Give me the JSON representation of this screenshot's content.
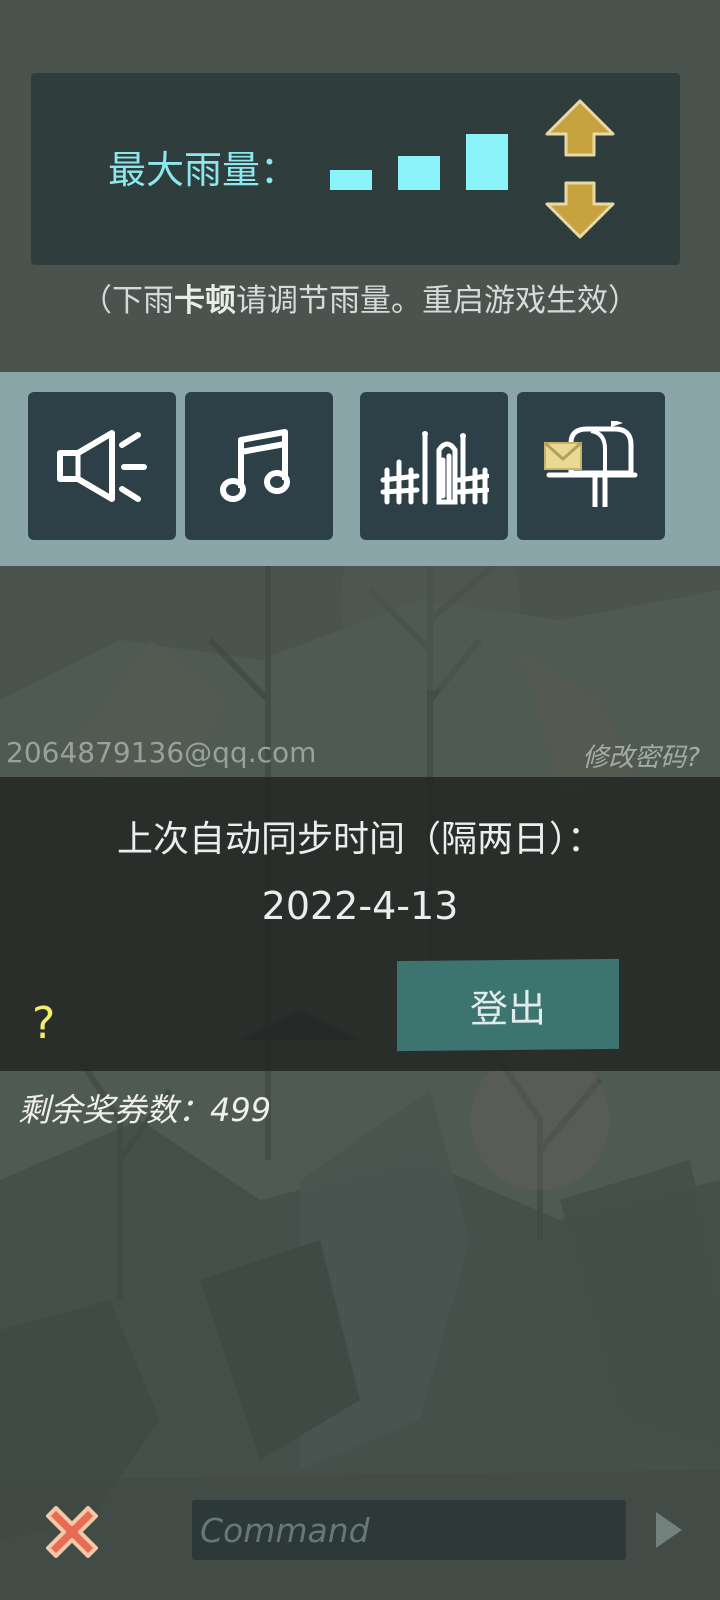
{
  "rain": {
    "label": "最大雨量：",
    "level": 3,
    "levels_total": 3,
    "note_prefix": "（下雨",
    "note_bold": "卡顿",
    "note_suffix": "请调节雨量。重启游戏生效）"
  },
  "toolbar": {
    "items": [
      {
        "icon": "speaker-icon"
      },
      {
        "icon": "music-note-icon"
      },
      {
        "icon": "fence-gate-icon"
      },
      {
        "icon": "mailbox-icon"
      }
    ]
  },
  "account": {
    "email": "2064879136@qq.com",
    "change_password": "修改密码?"
  },
  "sync": {
    "title": "上次自动同步时间（隔两日）：",
    "date": "2022-4-13",
    "logout_label": "登出",
    "help_label": "?"
  },
  "tickets": {
    "label": "剩余奖券数：",
    "count": "499"
  },
  "command": {
    "placeholder": "Command",
    "value": ""
  },
  "colors": {
    "accent_cyan": "#8bf3fa",
    "arrow_gold": "#c7a340",
    "logout_teal": "#3c7470",
    "close_red": "#e86b55",
    "help_yellow": "#f2ec6a"
  }
}
